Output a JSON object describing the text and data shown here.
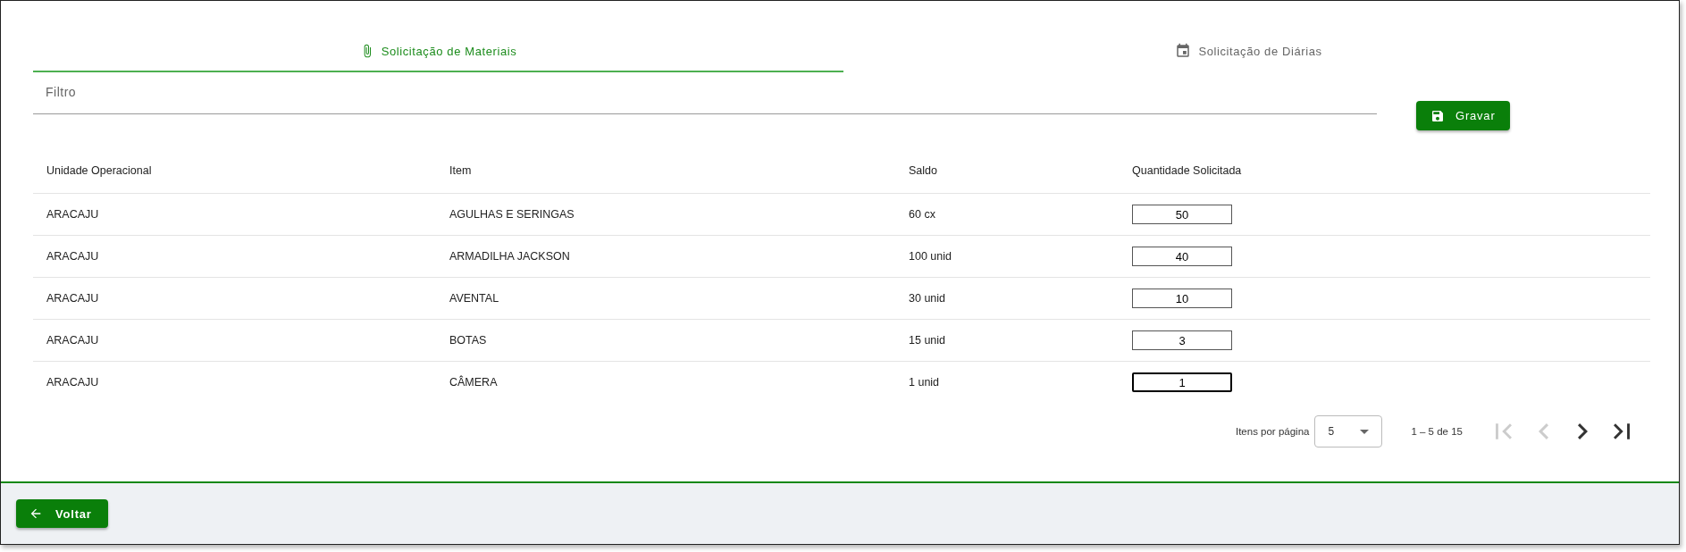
{
  "tabs": [
    {
      "label": "Solicitação de Materiais",
      "kind": "materials",
      "selected": true
    },
    {
      "label": "Solicitação de Diárias",
      "kind": "daily",
      "selected": false
    }
  ],
  "filter": {
    "placeholder": "Filtro"
  },
  "save_button": "Gravar",
  "table": {
    "columns": [
      "Unidade Operacional",
      "Item",
      "Saldo",
      "Quantidade Solicitada"
    ],
    "rows": [
      {
        "unit": "ARACAJU",
        "item": "AGULHAS E SERINGAS",
        "balance": "60 cx",
        "quantity": "50",
        "focused": false
      },
      {
        "unit": "ARACAJU",
        "item": "ARMADILHA JACKSON",
        "balance": "100 unid",
        "quantity": "40",
        "focused": false
      },
      {
        "unit": "ARACAJU",
        "item": "AVENTAL",
        "balance": "30 unid",
        "quantity": "10",
        "focused": false
      },
      {
        "unit": "ARACAJU",
        "item": "BOTAS",
        "balance": "15 unid",
        "quantity": "3",
        "focused": false
      },
      {
        "unit": "ARACAJU",
        "item": "CÂMERA",
        "balance": "1 unid",
        "quantity": "1",
        "focused": true
      }
    ]
  },
  "paginator": {
    "label": "Itens por página",
    "page_size": "5",
    "range": "1 – 5 de 15",
    "buttons": [
      {
        "kind": "first",
        "disabled": true
      },
      {
        "kind": "previous",
        "disabled": true
      },
      {
        "kind": "next",
        "disabled": false
      },
      {
        "kind": "last",
        "disabled": false
      }
    ]
  },
  "back_button": "Voltar"
}
